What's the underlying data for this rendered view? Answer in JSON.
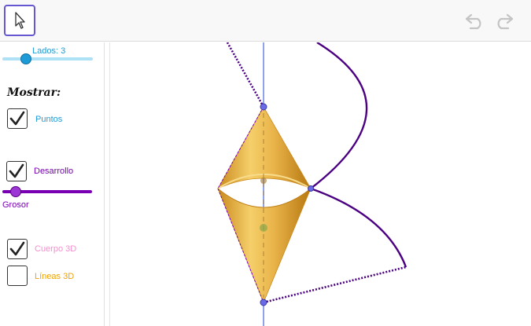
{
  "toolbar": {
    "move_tool": "cursor-arrow-icon",
    "undo": "undo-icon",
    "redo": "redo-icon"
  },
  "controls": {
    "lados_label": "Lados: 3",
    "lados_value": 3,
    "mostrar_label": "Mostrar:",
    "puntos_label": "Puntos",
    "puntos_checked": true,
    "desarrollo_label": "Desarrollo",
    "desarrollo_checked": true,
    "grosor_label": "Grosor",
    "cuerpo3d_label": "Cuerpo 3D",
    "cuerpo3d_checked": true,
    "lineas3d_label": "Líneas 3D",
    "lineas3d_checked": false
  },
  "colors": {
    "toolbar_accent": "#6557d2",
    "lados_slider": "#aee0f6",
    "lados_knob": "#1e9bd7",
    "puntos_text": "#1e9bd7",
    "desarrollo_text": "#7a00b4",
    "grosor_slider": "#7a00b4",
    "cuerpo_text": "#f48fcf",
    "lineas_text": "#f0a200",
    "axis": "#6a85e6",
    "net_lines": "#4b0082",
    "body_fill": "#f2c35a"
  }
}
